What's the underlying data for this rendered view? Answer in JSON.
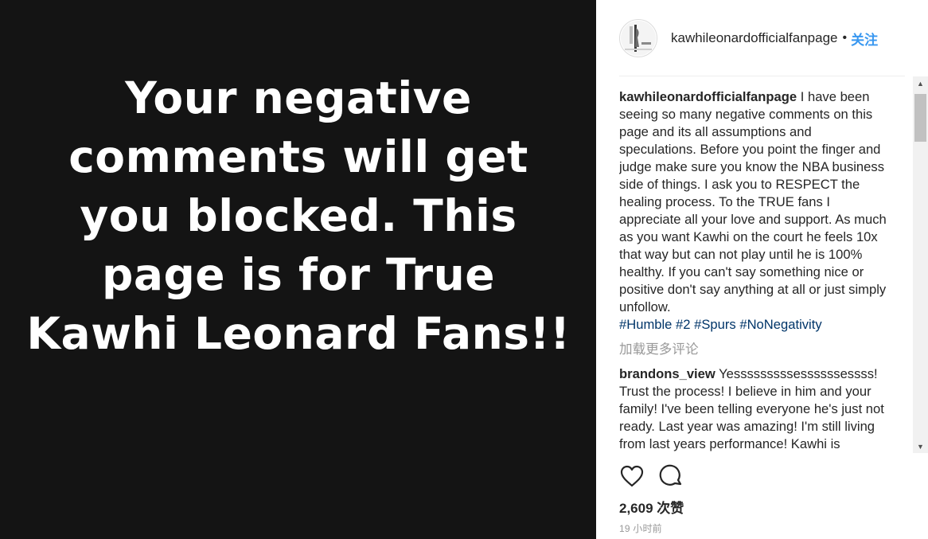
{
  "media": {
    "text": "Your negative comments will get you blocked. This page is for True Kawhi Leonard Fans!!"
  },
  "header": {
    "username": "kawhileonardofficialfanpage",
    "separator": "•",
    "follow_label": "关注"
  },
  "caption": {
    "username": "kawhileonardofficialfanpage",
    "text": " I have been seeing so many negative comments on this page and its all assumptions and speculations. Before you point the finger and judge make sure you know the NBA business side of things. I ask you to RESPECT the healing process. To the TRUE fans I appreciate all your love and support. As much as you want Kawhi on the court he feels 10x that way but can not play until he is 100% healthy. If you can't say something nice or positive don't say anything at all or just simply unfollow.",
    "hashtags": [
      "#Humble",
      "#2",
      "#Spurs",
      "#NoNegativity"
    ]
  },
  "load_more_label": "加载更多评论",
  "comments": [
    {
      "username": "brandons_view",
      "text": " Yesssssssssessssssessss! Trust the process! I believe in him and your family! I've been telling everyone he's just not ready. Last year was amazing! I'm still living from last years performance! Kawhi is"
    }
  ],
  "actions": {
    "like_icon": "heart-icon",
    "comment_icon": "comment-bubble-icon"
  },
  "likes": "2,609 次赞",
  "timestamp": "19 小时前",
  "colors": {
    "media_background": "#141414",
    "follow": "#3897f0",
    "hashtag": "#003569",
    "muted": "#999999"
  }
}
